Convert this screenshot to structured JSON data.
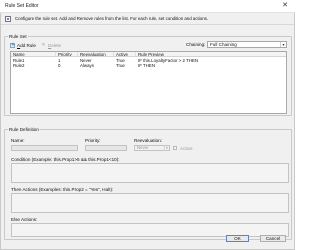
{
  "window": {
    "title": "Rule Set Editor",
    "close_glyph": "✕"
  },
  "header": {
    "description": "Configure the rule set. Add and Remove rules from the list. For each rule, set condition and actions."
  },
  "rule_set": {
    "group_label": "Rule Set",
    "add_rule_prefix": "A",
    "add_rule_rest": "dd Rule",
    "delete_prefix": "D",
    "delete_rest": "elete",
    "chaining_label": "Chaining:",
    "chaining_value": "Full Chaining",
    "columns": [
      "Name",
      "Priority",
      "Reevaluation",
      "Active",
      "Rule Preview"
    ],
    "rows": [
      [
        "Rule1",
        "1",
        "Never",
        "True",
        "IF this.LoyaltyFactor > 2 THEN"
      ],
      [
        "Rule2",
        "0",
        "Always",
        "True",
        "IF THEN"
      ]
    ]
  },
  "rule_definition": {
    "group_label": "Rule Definition",
    "name_label": "Name:",
    "priority_label": "Priority:",
    "reevaluation_label": "Reevaluation:",
    "reevaluation_value": "Never",
    "active_label": "Active",
    "condition_label": "Condition (Example: this.Prop1>5 && this.Prop1<10):",
    "then_label": "Then Actions (Examples: this.Prop2 = \"Yes\", Halt):",
    "else_label": "Else Actions:"
  },
  "buttons": {
    "ok": "OK",
    "cancel": "Cancel"
  },
  "icons": {
    "add": "add-rule-icon",
    "delete": "delete-icon",
    "dropdown": "chevron-down-icon"
  }
}
